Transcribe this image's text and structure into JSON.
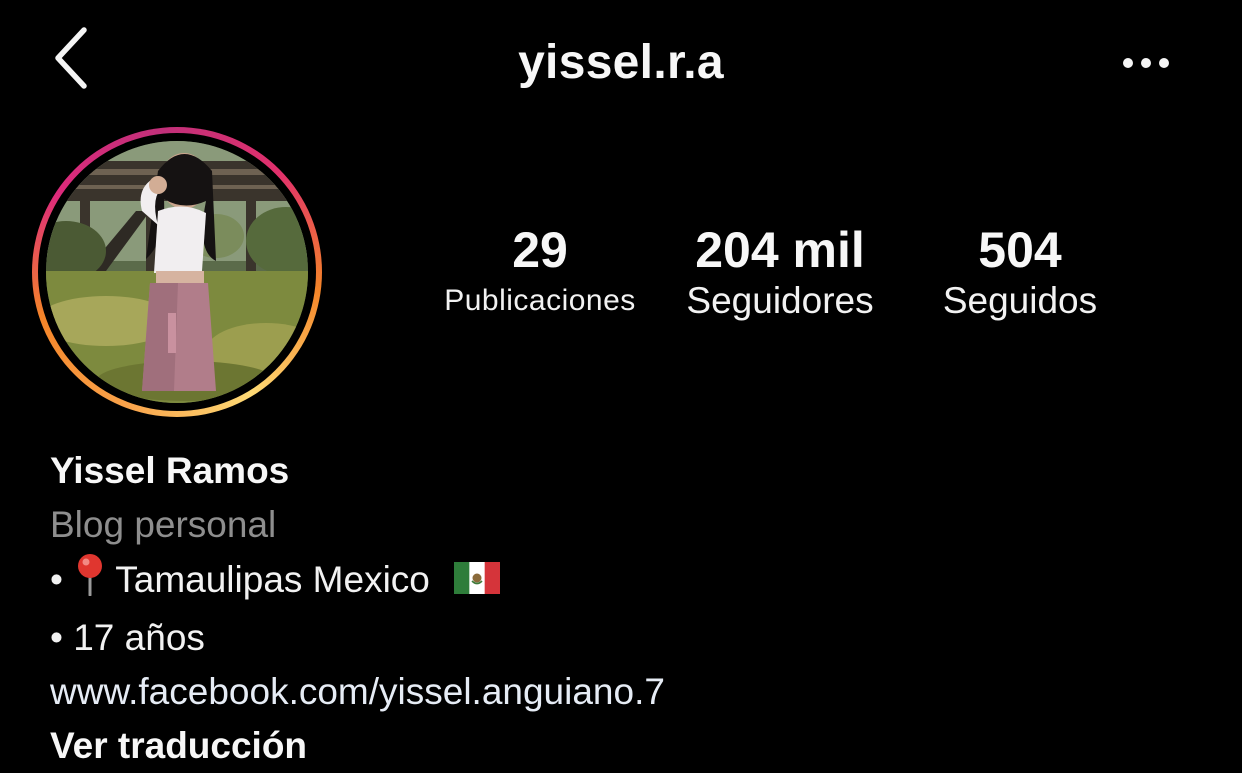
{
  "header": {
    "username": "yissel.r.a",
    "back_icon": "chevron-left-icon",
    "more_icon": "more-horizontal-icon"
  },
  "profile": {
    "avatar_ring_colors": [
      "#feda75",
      "#f58529",
      "#dd2a7b",
      "#c1307a"
    ],
    "stats": {
      "posts": {
        "value": "29",
        "label": "Publicaciones"
      },
      "followers": {
        "value": "204 mil",
        "label": "Seguidores"
      },
      "following": {
        "value": "504",
        "label": "Seguidos"
      }
    }
  },
  "bio": {
    "name": "Yissel Ramos",
    "category": "Blog personal",
    "line1_bullet": "•",
    "line1_icon": "round-pushpin-icon",
    "line1_text": "Tamaulipas Mexico",
    "line1_flag": "mexico-flag-icon",
    "line2": "• 17 años",
    "link": "www.facebook.com/yissel.anguiano.7",
    "translate": "Ver traducción"
  },
  "colors": {
    "background": "#000000",
    "text": "#f5f5f5",
    "category_text": "#8e8e8e"
  }
}
